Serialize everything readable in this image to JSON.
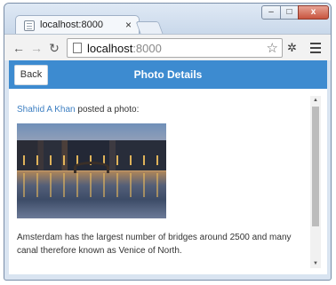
{
  "browser": {
    "tab_title": "localhost:8000",
    "tab_close": "×",
    "url_host": "localhost",
    "url_port": ":8000",
    "icons": {
      "back": "arrow-left",
      "forward": "arrow-right",
      "reload": "reload",
      "bookmark": "star",
      "extension": "puzzle",
      "menu": "hamburger"
    },
    "window_controls": {
      "minimize": "–",
      "maximize": "□",
      "close": "x"
    }
  },
  "app": {
    "header_color": "#3d8bd0",
    "title": "Photo Details",
    "back_label": "Back"
  },
  "post": {
    "author": "Shahid A Khan",
    "action": " posted a photo:",
    "photo_alt": "Amsterdam canal at dusk",
    "caption": "Amsterdam has the largest number of bridges around 2500 and many canal therefore known as Venice of North."
  }
}
